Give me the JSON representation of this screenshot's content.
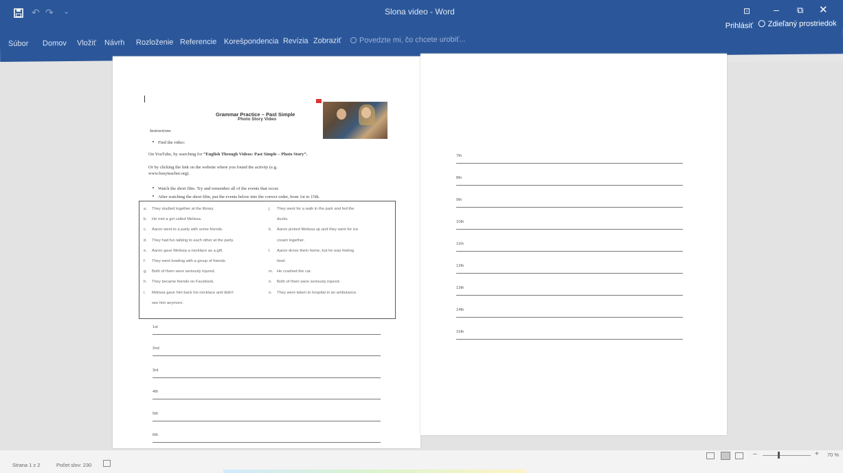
{
  "window": {
    "title": "Slona video - Word",
    "controls": {
      "options": "⊡",
      "minimize": "–",
      "maximize": "⧉",
      "close": "✕"
    }
  },
  "quick_access": {
    "undo": "↶",
    "redo": "↷",
    "more": "⌄"
  },
  "ribbon": {
    "tabs": [
      "Súbor",
      "Domov",
      "Vložiť",
      "Návrh",
      "Rozloženie",
      "Referencie",
      "Korešpondencia",
      "Revízia",
      "Zobraziť"
    ],
    "tell_me": "Povedzte mi, čo chcete urobiť...",
    "sign_in": "Prihlásiť",
    "share": "Zdieľaný prostriedok"
  },
  "document": {
    "title": "Grammar Practice – Past Simple",
    "subtitle": "Photo Story Video",
    "instructions_heading": "Instructions",
    "bullet_find": "Find the video:",
    "para_youtube_pre": "On YouTube, by searching for ",
    "para_youtube_bold": "“English Through Videos: Past Simple – Photo Story”.",
    "para_link_1": "Or by clicking the link on the website where you found the activity (e.g.",
    "para_link_2": "www.busyteacher.org).",
    "bullet_watch": "Watch the short film. Try and remember all of the events that occur.",
    "bullet_order": "After watching the short film, put the events below into the correct order, from 1st to 15th.",
    "events_left": [
      {
        "key": "a.",
        "text": "They studied together at the library."
      },
      {
        "key": "b.",
        "text": "He met a girl called Melissa."
      },
      {
        "key": "c.",
        "text": "Aaron went to a party with some friends."
      },
      {
        "key": "d.",
        "text": "They had fun talking to each other at the party."
      },
      {
        "key": "e.",
        "text": "Aaron gave Melissa a necklace as a gift."
      },
      {
        "key": "f.",
        "text": "They went bowling with a group of friends."
      },
      {
        "key": "g.",
        "text": "Both of them were seriously injured."
      },
      {
        "key": "h.",
        "text": "They became friends on Facebook."
      },
      {
        "key": "i.",
        "text": "Melissa gave him back his necklace and didn't"
      },
      {
        "key": "",
        "text": "see him anymore."
      }
    ],
    "events_right": [
      {
        "key": "j.",
        "text": "They went for a walk in the park and fed the"
      },
      {
        "key": "",
        "text": "ducks."
      },
      {
        "key": "k.",
        "text": "Aaron picked Melissa up and they went for ice"
      },
      {
        "key": "",
        "text": "cream together."
      },
      {
        "key": "l.",
        "text": "Aaron drove them home, but he was feeling"
      },
      {
        "key": "",
        "text": "tired."
      },
      {
        "key": "m.",
        "text": "He crashed the car."
      },
      {
        "key": "n.",
        "text": "Both of them were seriously injured."
      },
      {
        "key": "o.",
        "text": "They were taken to hospital in an ambulance."
      }
    ],
    "answers_page1": [
      "1st",
      "2nd",
      "3rd",
      "4th",
      "5th",
      "6th"
    ],
    "answers_page2": [
      "7th",
      "8th",
      "9th",
      "10th",
      "11th",
      "12th",
      "13th",
      "14th",
      "15th"
    ]
  },
  "status": {
    "page": "Strana 1 z 2",
    "words": "Počet slov: 230",
    "zoom": "70 %",
    "zoom_minus": "–",
    "zoom_plus": "+"
  }
}
